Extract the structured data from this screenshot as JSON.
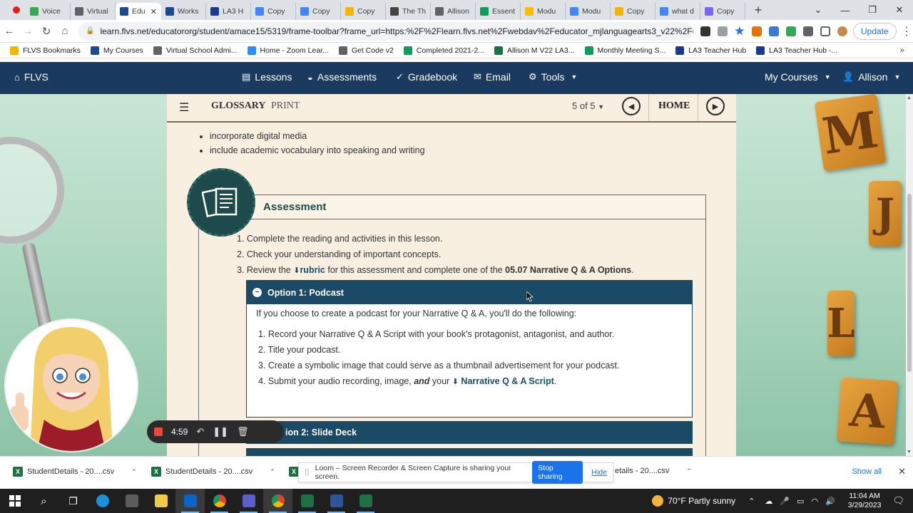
{
  "browser": {
    "tabs": [
      {
        "label": "Voice",
        "color": "#34a853"
      },
      {
        "label": "Virtual",
        "color": "#5f6368"
      },
      {
        "label": "Edu",
        "color": "#1b4a8f",
        "active": true
      },
      {
        "label": "Works",
        "color": "#1b4a8f"
      },
      {
        "label": "LA3 H",
        "color": "#1b3a8f"
      },
      {
        "label": "Copy",
        "color": "#4285f4"
      },
      {
        "label": "Copy",
        "color": "#4285f4"
      },
      {
        "label": "Copy",
        "color": "#f4b400"
      },
      {
        "label": "The Th",
        "color": "#444444"
      },
      {
        "label": "Allison",
        "color": "#5f6368"
      },
      {
        "label": "Essent",
        "color": "#0f9d58"
      },
      {
        "label": "Modu",
        "color": "#fbbc04"
      },
      {
        "label": "Modu",
        "color": "#4285f4"
      },
      {
        "label": "Copy",
        "color": "#f4b400"
      },
      {
        "label": "what d",
        "color": "#4285f4"
      },
      {
        "label": "Copy",
        "color": "#7b68ee"
      }
    ],
    "active_close": "✕",
    "url": "learn.flvs.net/educatororg/student/amace15/5319/frame-toolbar?frame_url=https:%2F%2Flearn.flvs.net%2Fwebdav%2Feducator_mjlanguagearts3_v22%2Fin...",
    "update_label": "Update",
    "bookmarks": [
      {
        "label": "FLVS Bookmarks",
        "color": "#f4b400"
      },
      {
        "label": "My Courses",
        "color": "#1b4a8f"
      },
      {
        "label": "Virtual School Admi...",
        "color": "#5f6368"
      },
      {
        "label": "Home - Zoom Lear...",
        "color": "#2d8cff"
      },
      {
        "label": "Get Code v2",
        "color": "#5f6368"
      },
      {
        "label": "Completed 2021-2...",
        "color": "#0f9d58"
      },
      {
        "label": "Allison M V22 LA3...",
        "color": "#1d7044"
      },
      {
        "label": "Monthly Meeting S...",
        "color": "#0f9d58"
      },
      {
        "label": "LA3 Teacher Hub",
        "color": "#1b3a8f"
      },
      {
        "label": "LA3 Teacher Hub -...",
        "color": "#1b3a8f"
      }
    ]
  },
  "site": {
    "brand": "FLVS",
    "nav": {
      "lessons": "Lessons",
      "assessments": "Assessments",
      "gradebook": "Gradebook",
      "email": "Email",
      "tools": "Tools",
      "my_courses": "My Courses",
      "user": "Allison"
    }
  },
  "toolbar": {
    "glossary": "GLOSSARY",
    "print": "PRINT",
    "pages": "5 of 5",
    "home": "HOME"
  },
  "content": {
    "bullets": [
      "incorporate digital media",
      "include academic vocabulary into speaking and writing"
    ],
    "assessment_title": "Assessment",
    "step1": "1. Complete the reading and activities in this lesson.",
    "step2": "2. Check your understanding of important concepts.",
    "step3_pre": "3. Review the",
    "step3_link": "rubric",
    "step3_mid": "for this assessment and complete one of the",
    "step3_bold": "05.07 Narrative Q & A Options",
    "step3_end": ".",
    "option1": {
      "title": "Option 1: Podcast",
      "intro": "If you choose to create a podcast for your Narrative Q & A, you'll do the following:",
      "s1": "1. Record your Narrative Q & A Script with your book's protagonist, antagonist, and author.",
      "s2": "2. Title your podcast.",
      "s3": "3. Create a symbolic image that could serve as a thumbnail advertisement for your podcast.",
      "s4_pre": "4. Submit your audio recording, image,",
      "s4_and": "and",
      "s4_mid": "your",
      "s4_link": "Narrative Q & A Script",
      "s4_end": "."
    },
    "option2_title": "ion 2: Slide Deck"
  },
  "loom": {
    "timer": "4:59",
    "share_msg": "Loom – Screen Recorder & Screen Capture is sharing your screen.",
    "stop_sharing": "Stop sharing",
    "hide": "Hide"
  },
  "downloads": {
    "items": [
      "StudentDetails - 20....csv",
      "StudentDetails - 20....csv",
      "etails - 20....csv"
    ],
    "show_all": "Show all"
  },
  "tiles": [
    "M",
    "J",
    "L",
    "A"
  ],
  "taskbar": {
    "weather": "70°F  Partly sunny",
    "time": "11:04 AM",
    "date": "3/29/2023"
  }
}
